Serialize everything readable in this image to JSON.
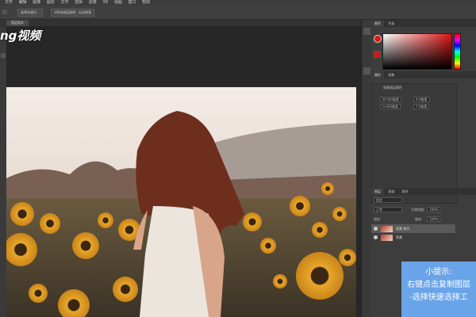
{
  "menubar": {
    "items": [
      "文件",
      "编辑",
      "图像",
      "图层",
      "文字",
      "选择",
      "滤镜",
      "3D",
      "视图",
      "窗口",
      "帮助"
    ]
  },
  "options_bar": {
    "buttons": [
      "选择并遮住...",
      "对所有图层取样",
      "自动增强"
    ]
  },
  "document": {
    "tab_label": "图层副本"
  },
  "watermark": {
    "text": "ng视频"
  },
  "panels": {
    "color": {
      "tabs": [
        "颜色",
        "色板"
      ],
      "foreground": "#e01313",
      "background": "#e01313"
    },
    "properties": {
      "tabs": [
        "属性",
        "调整"
      ],
      "header": "像素图层属性",
      "fields": [
        "W 600像素",
        "X 0像素",
        "H 400像素",
        "Y 0像素"
      ]
    },
    "layers": {
      "tabs": [
        "图层",
        "通道",
        "路径"
      ],
      "search_placeholder": "类型",
      "blend_mode": "正常",
      "opacity_label": "不透明度:",
      "opacity_value": "100%",
      "lock_label": "锁定:",
      "fill_label": "填充:",
      "fill_value": "100%",
      "rows": [
        {
          "name": "背景 拷贝"
        },
        {
          "name": "背景"
        }
      ]
    }
  },
  "hint": {
    "title": "小提示:",
    "line1": "右键点击复制图层",
    "line2": "-选择快速选择工"
  },
  "colors": {
    "accent_hint": "#6aa4e8"
  }
}
